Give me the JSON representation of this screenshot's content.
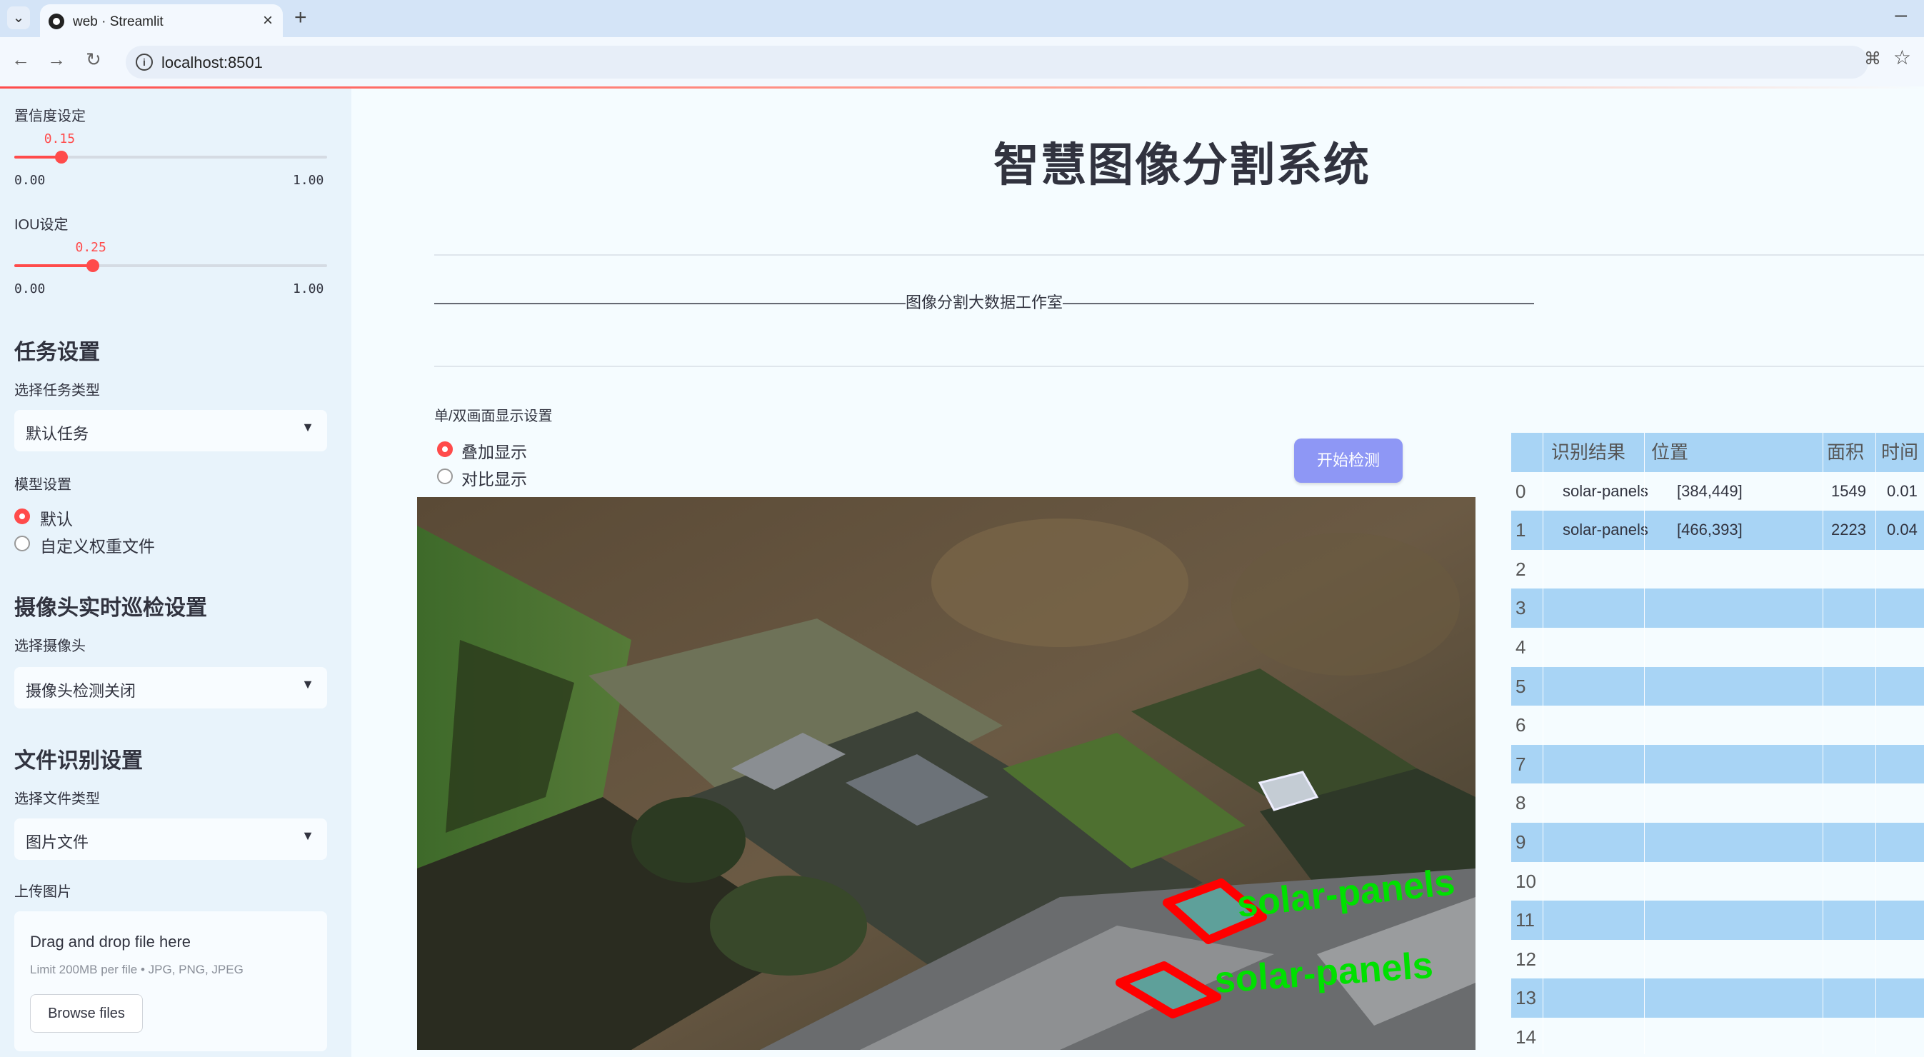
{
  "browser": {
    "tab_title": "web · Streamlit",
    "url": "localhost:8501"
  },
  "sidebar": {
    "confidence": {
      "label": "置信度设定",
      "value": "0.15",
      "value_num": 0.15,
      "min": "0.00",
      "max": "1.00"
    },
    "iou": {
      "label": "IOU设定",
      "value": "0.25",
      "value_num": 0.25,
      "min": "0.00",
      "max": "1.00"
    },
    "task_heading": "任务设置",
    "task_type_label": "选择任务类型",
    "task_type_value": "默认任务",
    "model_label": "模型设置",
    "model_options": [
      "默认",
      "自定义权重文件"
    ],
    "model_selected": "默认",
    "camera_heading": "摄像头实时巡检设置",
    "camera_label": "选择摄像头",
    "camera_value": "摄像头检测关闭",
    "file_heading": "文件识别设置",
    "file_type_label": "选择文件类型",
    "file_type_value": "图片文件",
    "upload_label": "上传图片",
    "upload_title": "Drag and drop file here",
    "upload_limit": "Limit 200MB per file • JPG, PNG, JPEG",
    "browse_label": "Browse files"
  },
  "main": {
    "title": "智慧图像分割系统",
    "banner": "——————————————————————————————图像分割大数据工作室——————————————————————————————",
    "display_label": "单/双画面显示设置",
    "display_options": [
      "叠加显示",
      "对比显示"
    ],
    "display_selected": "叠加显示",
    "start_button": "开始检测",
    "detections": [
      {
        "label": "solar-panels",
        "color": "#00e000"
      },
      {
        "label": "solar-panels",
        "color": "#00e000"
      }
    ],
    "box_color": "#ff0000"
  },
  "table": {
    "headers": [
      "识别结果",
      "位置",
      "面积",
      "时间"
    ],
    "rows": [
      {
        "idx": "0",
        "result": "solar-panels",
        "position": "[384,449]",
        "area": "1549",
        "time": "0.01"
      },
      {
        "idx": "1",
        "result": "solar-panels",
        "position": "[466,393]",
        "area": "2223",
        "time": "0.04"
      },
      {
        "idx": "2",
        "result": "",
        "position": "",
        "area": "",
        "time": ""
      },
      {
        "idx": "3",
        "result": "",
        "position": "",
        "area": "",
        "time": ""
      },
      {
        "idx": "4",
        "result": "",
        "position": "",
        "area": "",
        "time": ""
      },
      {
        "idx": "5",
        "result": "",
        "position": "",
        "area": "",
        "time": ""
      },
      {
        "idx": "6",
        "result": "",
        "position": "",
        "area": "",
        "time": ""
      },
      {
        "idx": "7",
        "result": "",
        "position": "",
        "area": "",
        "time": ""
      },
      {
        "idx": "8",
        "result": "",
        "position": "",
        "area": "",
        "time": ""
      },
      {
        "idx": "9",
        "result": "",
        "position": "",
        "area": "",
        "time": ""
      },
      {
        "idx": "10",
        "result": "",
        "position": "",
        "area": "",
        "time": ""
      },
      {
        "idx": "11",
        "result": "",
        "position": "",
        "area": "",
        "time": ""
      },
      {
        "idx": "12",
        "result": "",
        "position": "",
        "area": "",
        "time": ""
      },
      {
        "idx": "13",
        "result": "",
        "position": "",
        "area": "",
        "time": ""
      },
      {
        "idx": "14",
        "result": "",
        "position": "",
        "area": "",
        "time": ""
      }
    ],
    "header_color": "#a8d4f5",
    "stripe_color": "#a8d4f5"
  }
}
